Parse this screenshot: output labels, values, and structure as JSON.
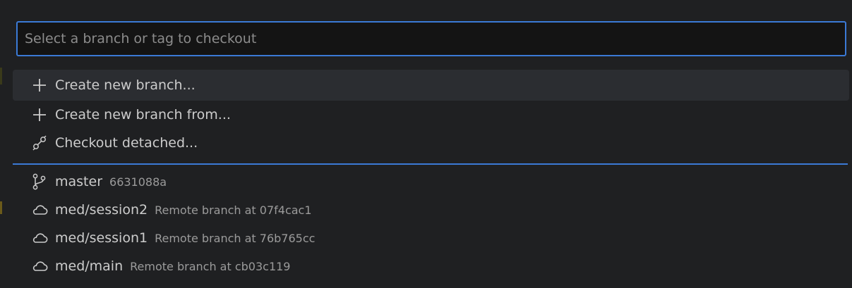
{
  "picker": {
    "placeholder": "Select a branch or tag to checkout",
    "value": ""
  },
  "actions": [
    {
      "icon": "plus-icon",
      "label": "Create new branch..."
    },
    {
      "icon": "plus-icon",
      "label": "Create new branch from..."
    },
    {
      "icon": "git-commit-detached-icon",
      "label": "Checkout detached..."
    }
  ],
  "branches": [
    {
      "icon": "git-branch-icon",
      "name": "master",
      "description": "6631088a"
    },
    {
      "icon": "cloud-icon",
      "name": "med/session2",
      "description": "Remote branch at 07f4cac1"
    },
    {
      "icon": "cloud-icon",
      "name": "med/session1",
      "description": "Remote branch at 76b765cc"
    },
    {
      "icon": "cloud-icon",
      "name": "med/main",
      "description": "Remote branch at cb03c119"
    }
  ],
  "colors": {
    "accent": "#3b7ad6",
    "background": "#1f2022",
    "active_row": "#2b2d31",
    "text": "#cccccc",
    "muted": "#9b9b9b"
  }
}
